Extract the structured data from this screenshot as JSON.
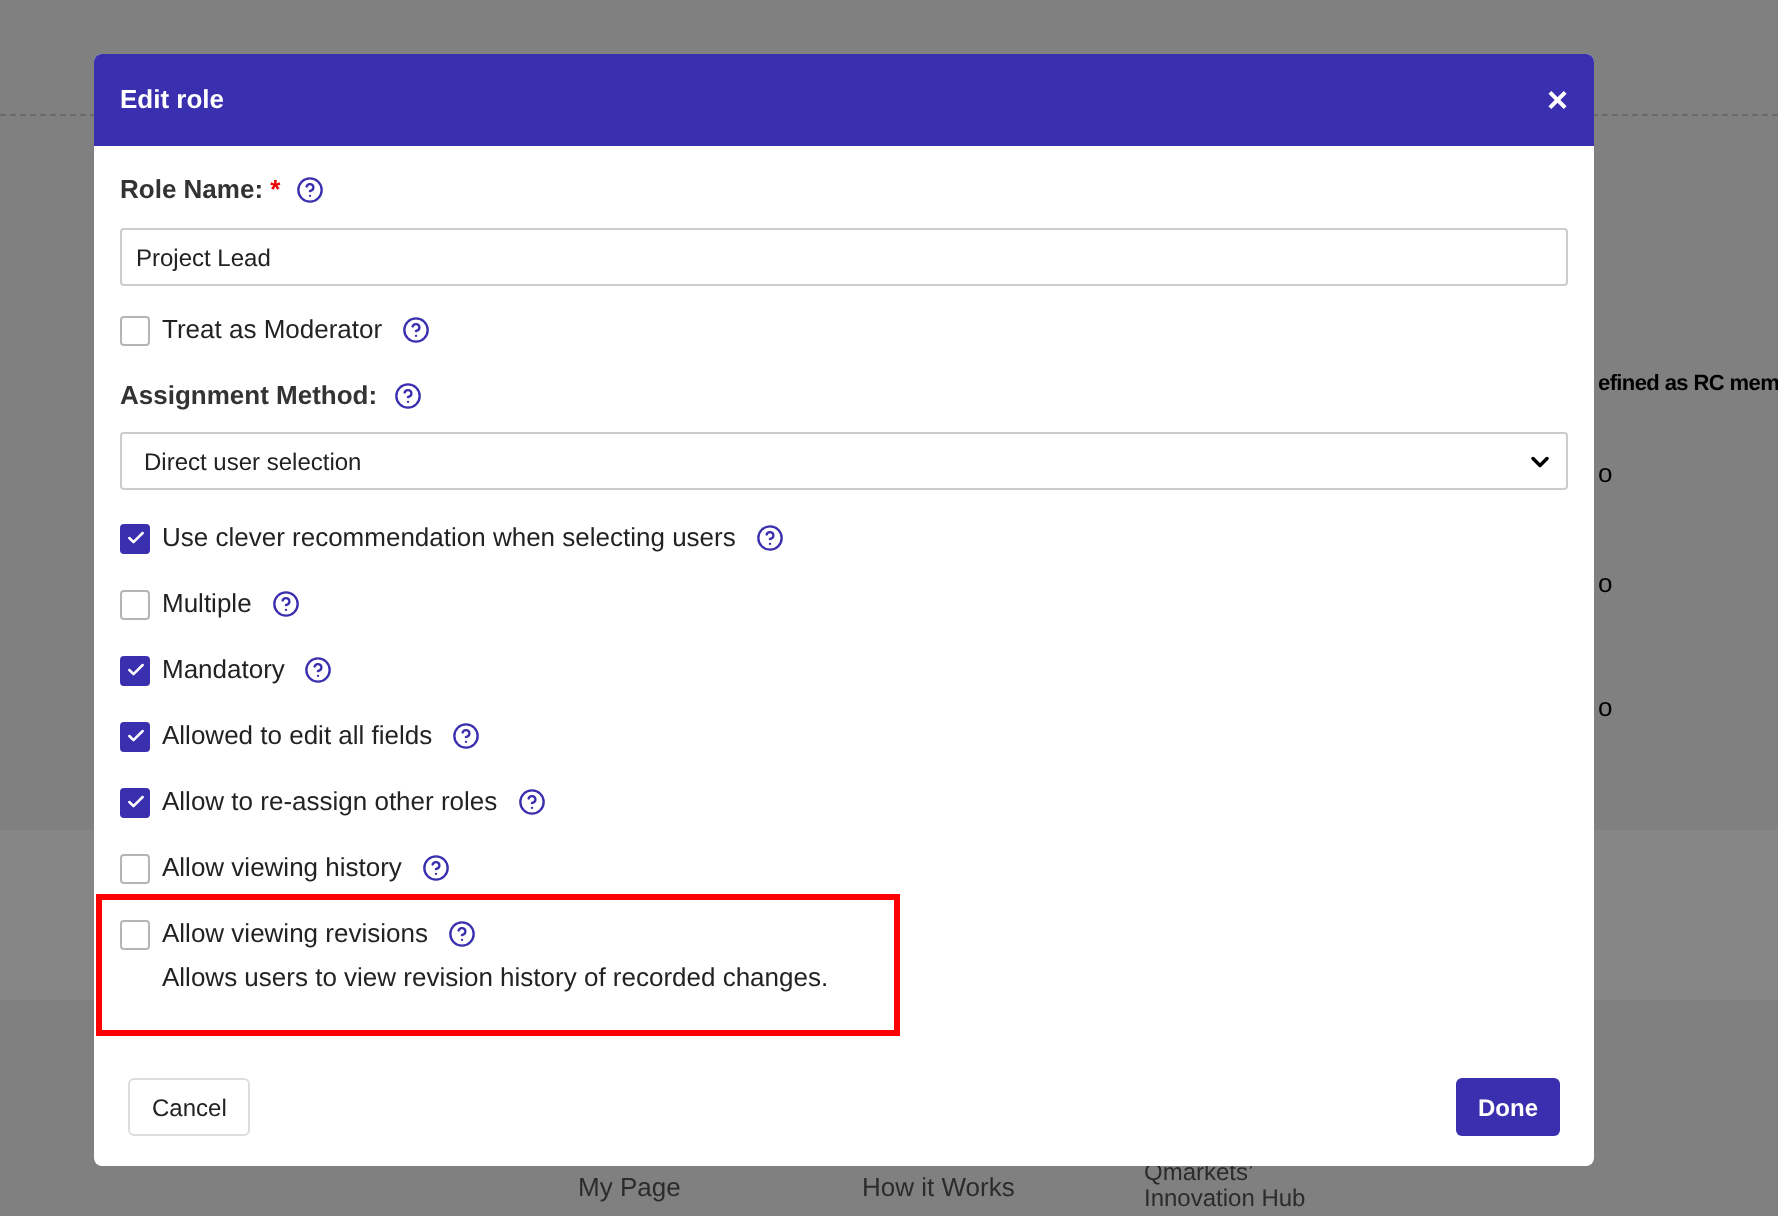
{
  "background": {
    "column_text": "efined as RC mem",
    "cells": [
      "o",
      "o",
      "o"
    ],
    "footer_links": [
      "My Page",
      "How it Works",
      "Qmarkets’ Innovation Hub"
    ]
  },
  "dialog": {
    "title": "Edit role",
    "close": "×",
    "role_name": {
      "label": "Role Name:",
      "required_mark": "*",
      "value": "Project Lead"
    },
    "moderator": {
      "label": "Treat as Moderator",
      "checked": false
    },
    "assignment": {
      "label": "Assignment Method:",
      "value": "Direct user selection"
    },
    "options": [
      {
        "label": "Use clever recommendation when selecting users",
        "checked": true,
        "highlighted": false
      },
      {
        "label": "Multiple",
        "checked": false,
        "highlighted": false
      },
      {
        "label": "Mandatory",
        "checked": true,
        "highlighted": false
      },
      {
        "label": "Allowed to edit all fields",
        "checked": true,
        "highlighted": false
      },
      {
        "label": "Allow to re-assign other roles",
        "checked": true,
        "highlighted": false
      },
      {
        "label": "Allow viewing history",
        "checked": false,
        "highlighted": false
      },
      {
        "label": "Allow viewing revisions",
        "checked": false,
        "highlighted": true,
        "description": "Allows users to view revision history of recorded changes."
      }
    ],
    "buttons": {
      "cancel": "Cancel",
      "done": "Done"
    }
  }
}
